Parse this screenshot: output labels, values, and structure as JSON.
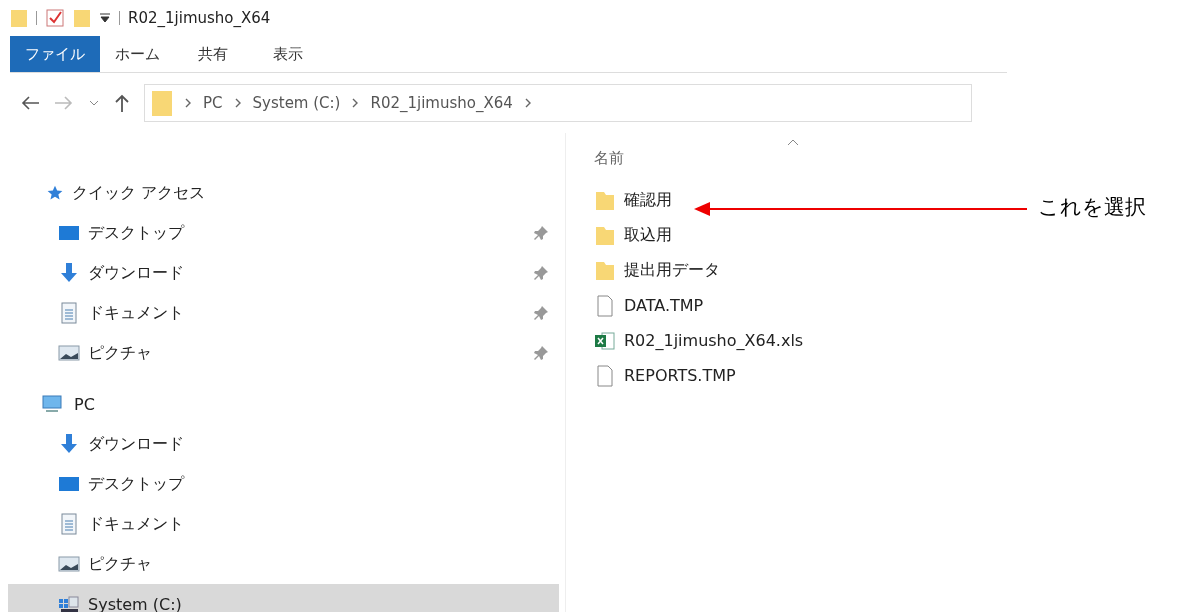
{
  "window": {
    "title": "R02_1jimusho_X64"
  },
  "ribbon_tabs": [
    {
      "label": "ファイル",
      "selected": true
    },
    {
      "label": "ホーム",
      "selected": false
    },
    {
      "label": "共有",
      "selected": false
    },
    {
      "label": "表示",
      "selected": false
    }
  ],
  "address_bar": {
    "path": [
      "PC",
      "System (C:)",
      "R02_1jimusho_X64"
    ]
  },
  "nav_pane": {
    "groups": [
      {
        "label": "クイック アクセス",
        "kind": "star",
        "children": [
          {
            "label": "デスクトップ",
            "kind": "desktop",
            "pinned": true,
            "selected": false
          },
          {
            "label": "ダウンロード",
            "kind": "download",
            "pinned": true,
            "selected": false
          },
          {
            "label": "ドキュメント",
            "kind": "document",
            "pinned": true,
            "selected": false
          },
          {
            "label": "ピクチャ",
            "kind": "pictures",
            "pinned": true,
            "selected": false
          }
        ]
      },
      {
        "label": "PC",
        "kind": "pc",
        "children": [
          {
            "label": "ダウンロード",
            "kind": "download",
            "pinned": false,
            "selected": false
          },
          {
            "label": "デスクトップ",
            "kind": "desktop",
            "pinned": false,
            "selected": false
          },
          {
            "label": "ドキュメント",
            "kind": "document",
            "pinned": false,
            "selected": false
          },
          {
            "label": "ピクチャ",
            "kind": "pictures",
            "pinned": false,
            "selected": false
          },
          {
            "label": "System (C:)",
            "kind": "drive",
            "pinned": false,
            "selected": true
          }
        ]
      }
    ]
  },
  "file_list": {
    "column": "名前",
    "items": [
      {
        "name": "確認用",
        "kind": "folder"
      },
      {
        "name": "取込用",
        "kind": "folder"
      },
      {
        "name": "提出用データ",
        "kind": "folder"
      },
      {
        "name": "DATA.TMP",
        "kind": "file"
      },
      {
        "name": "R02_1jimusho_X64.xls",
        "kind": "excel"
      },
      {
        "name": "REPORTS.TMP",
        "kind": "file"
      }
    ]
  },
  "annotation": {
    "text": "これを選択"
  }
}
